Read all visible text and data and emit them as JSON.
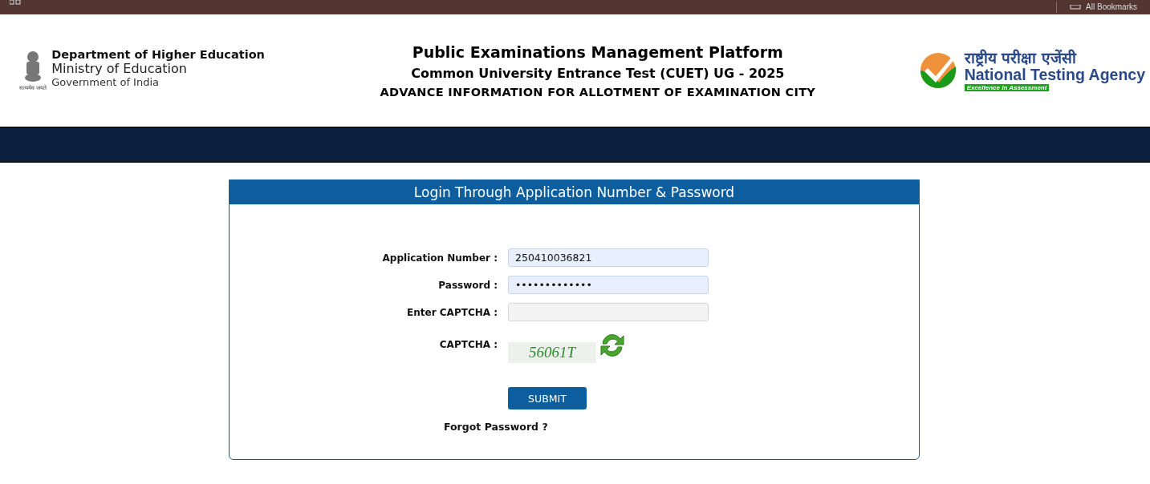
{
  "browser_bar": {
    "bookmarks_label": "All Bookmarks"
  },
  "header": {
    "left": {
      "line1": "Department of Higher Education",
      "line2": "Ministry of Education",
      "line3": "Government of India",
      "emblem_caption": "सत्यमेव जयते"
    },
    "center": {
      "title": "Public Examinations Management Platform",
      "subtitle": "Common University Entrance Test (CUET) UG - 2025",
      "notice": "ADVANCE INFORMATION FOR ALLOTMENT OF EXAMINATION CITY"
    },
    "right": {
      "hindi": "राष्ट्रीय परीक्षा एजेंसी",
      "name": "National Testing Agency",
      "tagline": "Excellence In Assessment"
    }
  },
  "login": {
    "title": "Login Through Application Number & Password",
    "fields": [
      {
        "label": "Application Number :",
        "value": "250410036821",
        "filled": true
      },
      {
        "label": "Password :",
        "value": "•••••••••••••",
        "filled": true
      },
      {
        "label": "Enter CAPTCHA :",
        "filled": false
      }
    ],
    "captcha": {
      "label": "CAPTCHA :",
      "code": "56061T"
    },
    "submit": "SUBMIT",
    "forgot": "Forgot Password ?"
  }
}
